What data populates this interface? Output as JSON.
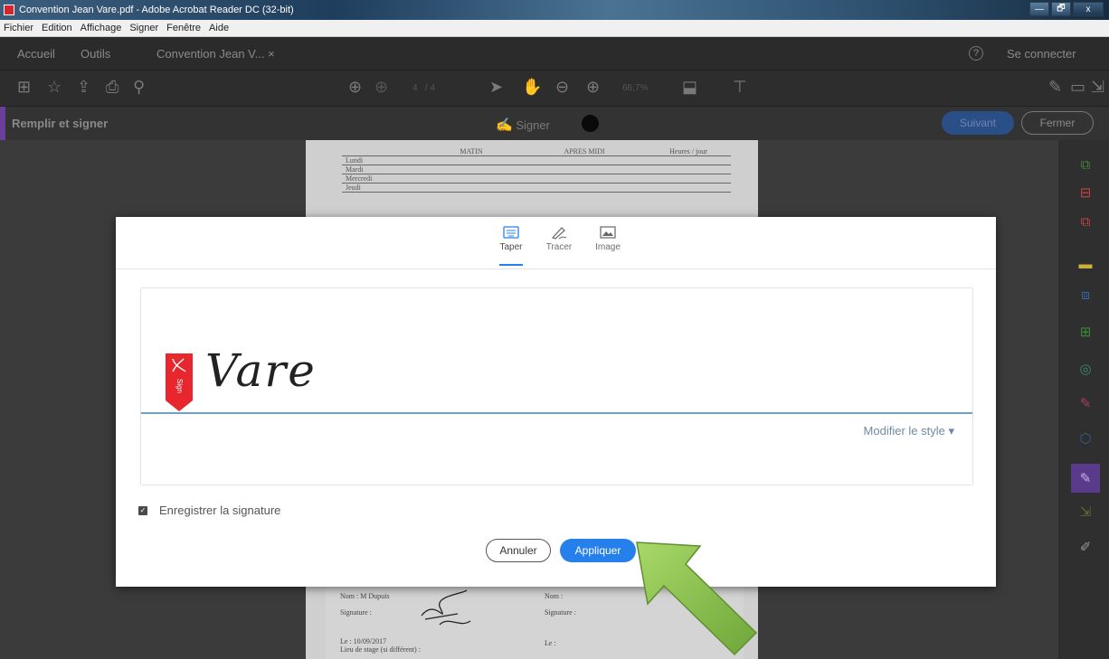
{
  "window": {
    "title": "Convention Jean Vare.pdf - Adobe Acrobat Reader DC (32-bit)",
    "controls": [
      "—",
      "🗗",
      "x"
    ]
  },
  "menu": {
    "items": [
      "Fichier",
      "Edition",
      "Affichage",
      "Signer",
      "Fenêtre",
      "Aide"
    ]
  },
  "tabs": {
    "accueil": "Accueil",
    "outils": "Outils",
    "document": "Convention Jean V... ×",
    "help": "?",
    "connect": "Se connecter"
  },
  "toolbar": {
    "page_num": "4",
    "page_total": "/ 4",
    "zoom": "66,7%"
  },
  "fill_sign": {
    "title": "Remplir et signer",
    "sign_label": "Signer",
    "ink_color": "#000000",
    "suivant": "Suivant",
    "fermer": "Fermer"
  },
  "schedule": {
    "headers": [
      "MATIN",
      "APRES MIDI",
      "Heures / jour"
    ],
    "days": [
      "Lundi",
      "Mardi",
      "Mercredi",
      "Jeudi"
    ]
  },
  "page_bottom": {
    "name_left": "Nom : M Dupuis",
    "signature_left": "Signature :",
    "date_left": "Le : 10/09/2017",
    "place_left": "Lieu de stage (si différent) :",
    "name_right": "Nom :",
    "signature_right": "Signature :",
    "date_right": "Le :"
  },
  "signature_dialog": {
    "tabs": {
      "taper": "Taper",
      "tracer": "Tracer",
      "image": "Image"
    },
    "flag_text": "Sign",
    "signature_text": "Vare",
    "modify_style": "Modifier le style ▾",
    "save_signature": "Enregistrer la signature",
    "save_checked": true,
    "cancel": "Annuler",
    "apply": "Appliquer"
  },
  "colors": {
    "accent_blue": "#2680eb",
    "adobe_red": "#e8262e",
    "arrow_green": "#8dbf4a",
    "purple_accent": "#6a3f9a"
  }
}
